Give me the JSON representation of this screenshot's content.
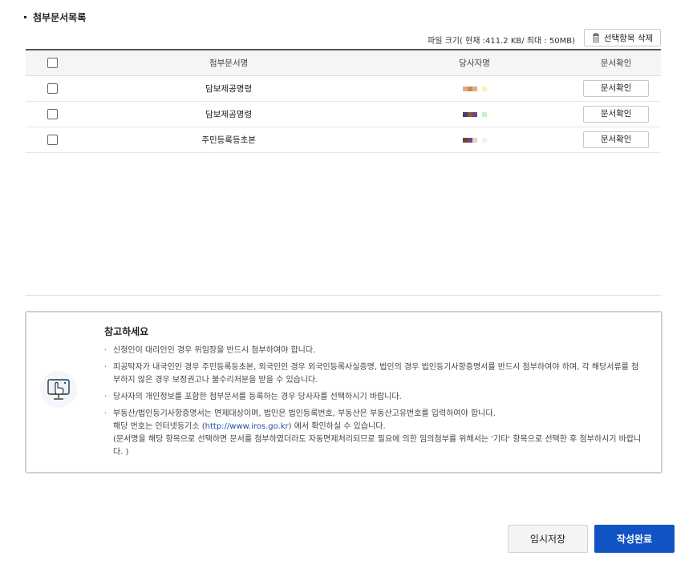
{
  "section": {
    "title": "첨부문서목록"
  },
  "file_size": {
    "text": "파일 크기( 현재 :411.2 KB/ 최대 : 50MB)"
  },
  "delete_button": {
    "label": "선택항목 삭제"
  },
  "table": {
    "headers": {
      "name": "첨부문서명",
      "party": "당사자명",
      "confirm": "문서확인"
    },
    "rows": [
      {
        "name": "담보제공명령",
        "confirm_label": "문서확인",
        "redact_colors": [
          "#e8a77a",
          "#c48a55",
          "#d9b27c",
          "#ffffff",
          "#fff3b0"
        ]
      },
      {
        "name": "담보제공명령",
        "confirm_label": "문서확인",
        "redact_colors": [
          "#4b3a6e",
          "#8a5a3a",
          "#6b4a8a",
          "#ffffff",
          "#c8f0c8"
        ]
      },
      {
        "name": "주민등록등초본",
        "confirm_label": "문서확인",
        "redact_colors": [
          "#7a3a3a",
          "#6b4a8a",
          "#f2c9c9",
          "#ffffff",
          "#e8f0ff"
        ]
      }
    ]
  },
  "notice": {
    "title": "참고하세요",
    "items": [
      {
        "text": "신청인이 대리인인 경우 위임장을 반드시 첨부하여야 합니다."
      },
      {
        "text": "피공탁자가 내국인인 경우 주민등록등초본, 외국인인 경우 외국인등록사실증명, 법인의 경우 법인등기사항증명서를 반드시 첨부하여야 하며, 각 해당서류를 첨부하지 않은 경우 보정권고나 불수리처분을 받을 수 있습니다."
      },
      {
        "text": "당사자의 개인정보를 포함한 첨부문서를 등록하는 경우 당사자를 선택하시기 바랍니다."
      },
      {
        "text_part1": "부동산/법인등기사항증명서는 면제대상이며, 법인은 법인등록번호, 부동산은 부동산고유번호를 입력하여야 합니다.",
        "text_part2_pre": "해당 번호는 인터넷등기소 (",
        "link": "http://www.iros.go.kr",
        "text_part2_post": ") 에서 확인하실 수 있습니다.",
        "text_part3": "(문서명을 해당 항목으로 선택하면 문서를 첨부하였더라도 자동면제처리되므로 필요에 의한 임의첨부를 위해서는 '기타' 항목으로 선택한 후 첨부하시기 바랍니다. )"
      }
    ]
  },
  "buttons": {
    "temp_save": "임시저장",
    "complete": "작성완료"
  },
  "colors": {
    "primary": "#1054c4",
    "notice_border": "#c9d3df"
  }
}
